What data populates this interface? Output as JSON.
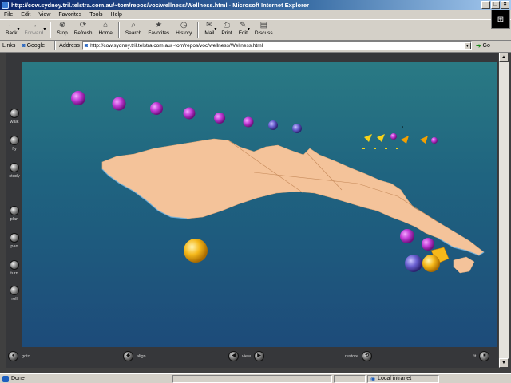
{
  "window": {
    "title": "http://cow.sydney.tril.telstra.com.au/~tom/repos/voc/wellness/Wellness.html - Microsoft Internet Explorer",
    "buttons": [
      "_",
      "□",
      "×"
    ]
  },
  "menu": [
    "File",
    "Edit",
    "View",
    "Favorites",
    "Tools",
    "Help"
  ],
  "toolbar": [
    {
      "label": "Back",
      "icon": "←",
      "name": "back",
      "disabled": false,
      "caret": true
    },
    {
      "label": "Forward",
      "icon": "→",
      "name": "forward",
      "disabled": true,
      "caret": true
    },
    {
      "label": "Stop",
      "icon": "⊗",
      "name": "stop",
      "disabled": false,
      "caret": false
    },
    {
      "label": "Refresh",
      "icon": "⟳",
      "name": "refresh",
      "disabled": false,
      "caret": false
    },
    {
      "label": "Home",
      "icon": "⌂",
      "name": "home",
      "disabled": false,
      "caret": false
    },
    {
      "label": "Search",
      "icon": "⌕",
      "name": "search",
      "disabled": false,
      "caret": false
    },
    {
      "label": "Favorites",
      "icon": "★",
      "name": "favorites",
      "disabled": false,
      "caret": false
    },
    {
      "label": "History",
      "icon": "◷",
      "name": "history",
      "disabled": false,
      "caret": false
    },
    {
      "label": "Mail",
      "icon": "✉",
      "name": "mail",
      "disabled": false,
      "caret": true
    },
    {
      "label": "Print",
      "icon": "⎙",
      "name": "print",
      "disabled": false,
      "caret": false
    },
    {
      "label": "Edit",
      "icon": "✎",
      "name": "edit",
      "disabled": false,
      "caret": true
    },
    {
      "label": "Discuss",
      "icon": "▤",
      "name": "discuss",
      "disabled": false,
      "caret": false
    }
  ],
  "linksbar": {
    "links_label": "Links",
    "google_label": "Google",
    "address_label": "Address",
    "address_value": "http://cow.sydney.tril.telstra.com.au/~tom/repos/voc/wellness/Wellness.html",
    "go_label": "Go"
  },
  "viewer": {
    "left_nav": [
      "walk",
      "fly",
      "study",
      "plan",
      "pan",
      "turn",
      "roll"
    ],
    "bottom_controls": {
      "goto": "goto",
      "align": "align",
      "view": "view",
      "restore": "restore",
      "fit": "fit"
    },
    "colors": {
      "land": "#f4c39a",
      "water_top": "#2a7a84",
      "water_bottom": "#1d4b7a",
      "magenta_sphere": "#c23bd6",
      "blue_sphere": "#6a5fd0",
      "gold_sphere": "#f5b81a"
    }
  },
  "status": {
    "text": "Done",
    "zone": "Local intranet"
  }
}
